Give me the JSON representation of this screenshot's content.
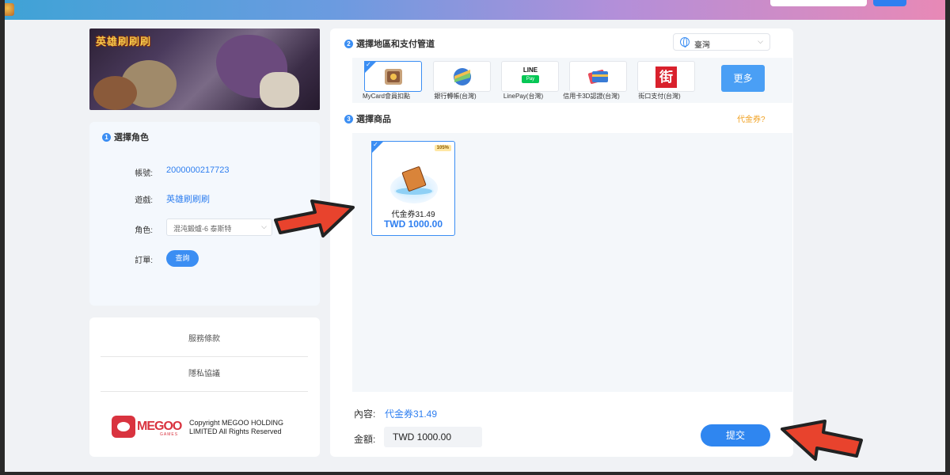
{
  "header": {
    "avatar_icon": "game-logo-icon"
  },
  "banner": {
    "game_title": "英雄刷刷刷"
  },
  "role_panel": {
    "step": "1",
    "title": "選擇角色",
    "account_label": "帳號:",
    "account_value": "2000000217723",
    "game_label": "遊戲:",
    "game_value": "英雄刷刷刷",
    "role_label": "角色:",
    "role_value": "混沌鍛爐-6 泰斯特",
    "order_label": "訂單:",
    "query_button": "查詢"
  },
  "links_panel": {
    "terms": "服務條款",
    "privacy": "隱私協議",
    "brand": "MEGOO",
    "brand_sub": "GAMES",
    "copyright": "Copyright MEGOO HOLDING LIMITED All Rights Reserved"
  },
  "payment": {
    "step": "2",
    "title": "選擇地區和支付管道",
    "region": "臺灣",
    "methods": [
      {
        "label": "MyCard會員扣點",
        "icon": "mycard-icon",
        "selected": true
      },
      {
        "label": "銀行轉帳(台灣)",
        "icon": "bank-transfer-icon",
        "selected": false
      },
      {
        "label": "LinePay(台灣)",
        "icon": "linepay-icon",
        "selected": false,
        "icon_text_1": "LINE",
        "icon_text_2": "Pay"
      },
      {
        "label": "信用卡3D認證(台灣)",
        "icon": "credit-card-icon",
        "selected": false
      },
      {
        "label": "街口支付(台灣)",
        "icon": "jkopay-icon",
        "selected": false,
        "icon_text_1": "街"
      }
    ],
    "more_button": "更多"
  },
  "products": {
    "step": "3",
    "title": "選擇商品",
    "voucher_link": "代金券?",
    "items": [
      {
        "badge": "105%",
        "name": "代金券31.49",
        "price": "TWD 1000.00",
        "selected": true
      }
    ]
  },
  "summary": {
    "content_label": "內容:",
    "content_value": "代金券31.49",
    "amount_label": "金額:",
    "amount_value": "TWD 1000.00",
    "submit_button": "提交"
  },
  "colors": {
    "accent": "#2f86f0",
    "link": "#2f7ff0",
    "voucher": "#f0a020",
    "arrow": "#e8432d"
  }
}
